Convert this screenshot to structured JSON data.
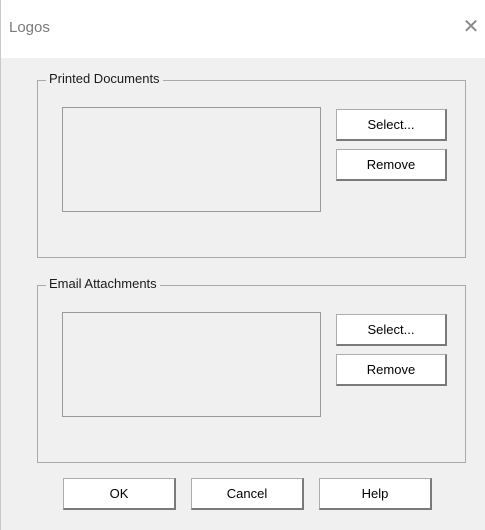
{
  "window": {
    "title": "Logos",
    "close_glyph": "✕"
  },
  "groups": [
    {
      "label": "Printed Documents",
      "select_label": "Select...",
      "remove_label": "Remove"
    },
    {
      "label": "Email Attachments",
      "select_label": "Select...",
      "remove_label": "Remove"
    }
  ],
  "footer": {
    "ok_label": "OK",
    "cancel_label": "Cancel",
    "help_label": "Help"
  },
  "icons": {
    "close": "close-icon"
  },
  "colors": {
    "dialog_background": "#f0f0f0",
    "titlebar_background": "#ffffff",
    "button_face": "#ffffff"
  }
}
